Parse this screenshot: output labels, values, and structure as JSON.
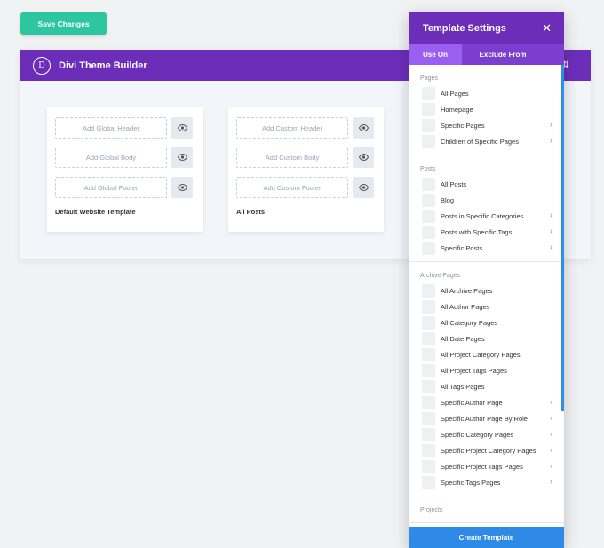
{
  "toolbar": {
    "save_label": "Save Changes"
  },
  "builder": {
    "logo_letter": "D",
    "title": "Divi Theme Builder",
    "templates": [
      {
        "name": "Default Website Template",
        "header": "Add Global Header",
        "body": "Add Global Body",
        "footer": "Add Global Footer"
      },
      {
        "name": "All Posts",
        "header": "Add Custom Header",
        "body": "Add Custom Body",
        "footer": "Add Custom Footer"
      }
    ]
  },
  "modal": {
    "title": "Template Settings",
    "close": "✕",
    "tabs": [
      "Use On",
      "Exclude From"
    ],
    "sections": [
      {
        "title": "Pages",
        "options": [
          {
            "label": "All Pages",
            "arrow": false
          },
          {
            "label": "Homepage",
            "arrow": false
          },
          {
            "label": "Specific Pages",
            "arrow": true
          },
          {
            "label": "Children of Specific Pages",
            "arrow": true
          }
        ]
      },
      {
        "title": "Posts",
        "options": [
          {
            "label": "All Posts",
            "arrow": false
          },
          {
            "label": "Blog",
            "arrow": false
          },
          {
            "label": "Posts in Specific Categories",
            "arrow": true
          },
          {
            "label": "Posts with Specific Tags",
            "arrow": true
          },
          {
            "label": "Specific Posts",
            "arrow": true
          }
        ]
      },
      {
        "title": "Archive Pages",
        "options": [
          {
            "label": "All Archive Pages",
            "arrow": false
          },
          {
            "label": "All Author Pages",
            "arrow": false
          },
          {
            "label": "All Category Pages",
            "arrow": false
          },
          {
            "label": "All Date Pages",
            "arrow": false
          },
          {
            "label": "All Project Category Pages",
            "arrow": false
          },
          {
            "label": "All Project Tags Pages",
            "arrow": false
          },
          {
            "label": "All Tags Pages",
            "arrow": false
          },
          {
            "label": "Specific Author Page",
            "arrow": true
          },
          {
            "label": "Specific Author Page By Role",
            "arrow": true
          },
          {
            "label": "Specific Category Pages",
            "arrow": true
          },
          {
            "label": "Specific Project Category Pages",
            "arrow": true
          },
          {
            "label": "Specific Project Tags Pages",
            "arrow": true
          },
          {
            "label": "Specific Tags Pages",
            "arrow": true
          }
        ]
      },
      {
        "title": "Projects",
        "options": []
      }
    ],
    "create_label": "Create Template"
  },
  "colors": {
    "accent_purple": "#6c2eb9",
    "save_green": "#2dc6a1",
    "create_blue": "#2e8ae6"
  }
}
